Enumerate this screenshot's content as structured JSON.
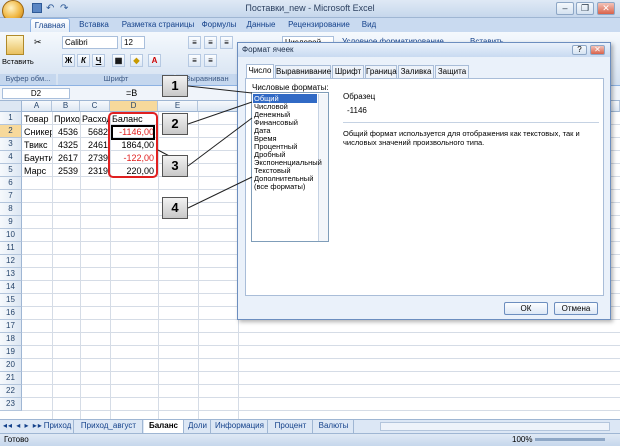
{
  "window": {
    "title": "Поставки_new - Microsoft Excel",
    "min": "–",
    "max": "❐",
    "close": "✕"
  },
  "ribbon_tabs": [
    "Главная",
    "Вставка",
    "Разметка страницы",
    "Формулы",
    "Данные",
    "Рецензирование",
    "Вид"
  ],
  "ribbon": {
    "paste_label": "Вставить",
    "font_name": "Calibri",
    "font_size": "12",
    "number_format": "Числовой",
    "conditional_formatting": "Условное форматирование",
    "insert_label": "Вставить",
    "groups": [
      "Буфер обм...",
      "Шрифт",
      "Выравниван"
    ]
  },
  "formula_bar": {
    "name_box": "D2",
    "fx": "=B"
  },
  "columns": [
    "A",
    "B",
    "C",
    "D",
    "E"
  ],
  "rows": [
    "1",
    "2",
    "3",
    "4",
    "5",
    "6",
    "7",
    "8",
    "9",
    "10",
    "11",
    "12",
    "13",
    "14",
    "15",
    "16",
    "17",
    "18",
    "19",
    "20",
    "21",
    "22",
    "23"
  ],
  "cells": {
    "header": [
      "Товар",
      "Приход",
      "Расход",
      "Баланс"
    ],
    "data": [
      {
        "item": "Сникерс",
        "in": "4536",
        "out": "5682",
        "balance": "-1146,00",
        "neg": true
      },
      {
        "item": "Твикс",
        "in": "4325",
        "out": "2461",
        "balance": "1864,00",
        "neg": false
      },
      {
        "item": "Баунти",
        "in": "2617",
        "out": "2739",
        "balance": "-122,00",
        "neg": true
      },
      {
        "item": "Марс",
        "in": "2539",
        "out": "2319",
        "balance": "220,00",
        "neg": false
      }
    ]
  },
  "sheet_tabs": [
    "Приход",
    "Приход_август",
    "Баланс",
    "Доли",
    "Информация",
    "Процент",
    "Валюты"
  ],
  "active_sheet": "Баланс",
  "status": {
    "ready": "Готово",
    "zoom": "100%"
  },
  "dialog": {
    "title": "Формат ячеек",
    "help": "?",
    "close": "✕",
    "tabs": [
      "Число",
      "Выравнивание",
      "Шрифт",
      "Граница",
      "Заливка",
      "Защита"
    ],
    "formats_label": "Числовые форматы:",
    "formats": [
      "Общий",
      "Числовой",
      "Денежный",
      "Финансовый",
      "Дата",
      "Время",
      "Процентный",
      "Дробный",
      "Экспоненциальный",
      "Текстовый",
      "Дополнительный",
      "(все форматы)"
    ],
    "selected": "Общий",
    "sample_label": "Образец",
    "sample_value": "-1146",
    "description": "Общий формат используется для отображения как текстовых, так и числовых значений произвольного типа.",
    "ok": "ОК",
    "cancel": "Отмена"
  },
  "callouts": [
    "1",
    "2",
    "3",
    "4"
  ],
  "colors": {
    "negative": "#e02020",
    "selection": "#316ac5",
    "accent": "#15428b"
  }
}
